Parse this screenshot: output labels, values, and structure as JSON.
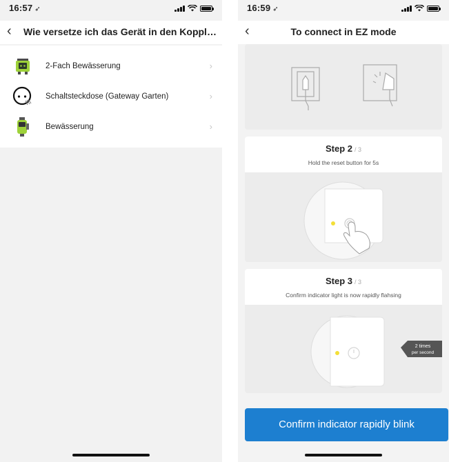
{
  "left_screen": {
    "status_time": "16:57",
    "title": "Wie versetze ich das Gerät in den Kopplu...",
    "devices": [
      {
        "label": "2-Fach Bewässerung",
        "icon": "water-timer-double-icon"
      },
      {
        "label": "Schaltsteckdose (Gateway Garten)",
        "icon": "smart-plug-icon"
      },
      {
        "label": "Bewässerung",
        "icon": "water-timer-icon"
      }
    ]
  },
  "right_screen": {
    "status_time": "16:59",
    "title": "To connect in EZ mode",
    "steps": [
      {
        "number": "Step 2",
        "of": "/ 3",
        "description": "Hold the reset button for 5s"
      },
      {
        "number": "Step 3",
        "of": "/ 3",
        "description": "Confirm indicator light is now rapidly flahsing"
      }
    ],
    "blink_label_line1": "2 times",
    "blink_label_line2": "per second",
    "confirm_button": "Confirm indicator rapidly blink"
  },
  "colors": {
    "accent": "#1d7fd0",
    "indicator_yellow": "#f3df38",
    "device_green": "#9ed23a"
  }
}
